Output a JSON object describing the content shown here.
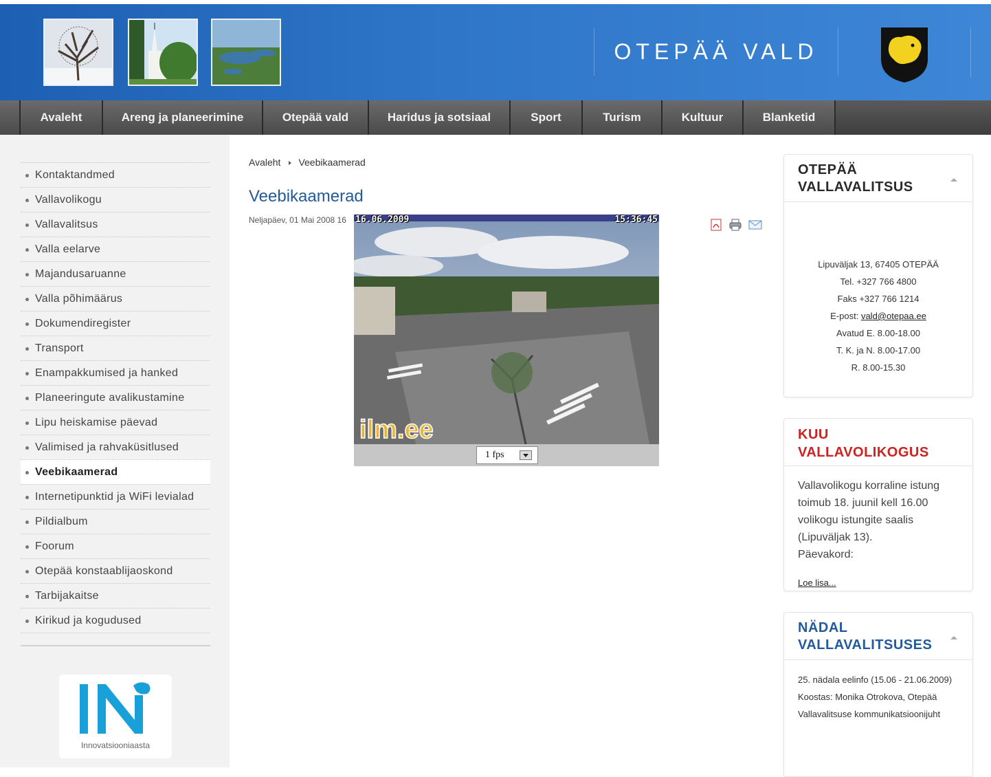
{
  "header": {
    "site_title": "OTEPÄÄ VALD",
    "colors": {
      "header_blue": "#2f76c8",
      "nav_gray": "#4a4a4a",
      "title_blue": "#245a9a",
      "news_red": "#cc2222"
    },
    "thumbnails": [
      "winter-tree-photo",
      "church-photo",
      "lake-aerial-photo"
    ],
    "crest_icon": "bear-crest-icon"
  },
  "nav": {
    "items": [
      "Avaleht",
      "Areng ja planeerimine",
      "Otepää vald",
      "Haridus ja sotsiaal",
      "Sport",
      "Turism",
      "Kultuur",
      "Blanketid"
    ]
  },
  "sidebar": {
    "items": [
      "Kontaktandmed",
      "Vallavolikogu",
      "Vallavalitsus",
      "Valla eelarve",
      "Majandusaruanne",
      "Valla põhimäärus",
      "Dokumendiregister",
      "Transport",
      "Enampakkumised ja hanked",
      "Planeeringute avalikustamine",
      "Lipu heiskamise päevad",
      "Valimised ja rahvaküsitlused",
      "Veebikaamerad",
      "Internetipunktid ja WiFi levialad",
      "Pildialbum",
      "Foorum",
      "Otepää konstaablijaoskond",
      "Tarbijakaitse",
      "Kirikud ja kogudused"
    ],
    "active": "Veebikaamerad",
    "logo_caption": "Innovatsiooniaasta"
  },
  "main": {
    "breadcrumb": [
      "Avaleht",
      "Veebikaamerad"
    ],
    "title": "Veebikaamerad",
    "date": "Neljapäev, 01 Mai 2008 16",
    "icons": [
      "pdf-icon",
      "print-icon",
      "email-icon"
    ],
    "webcam": {
      "date": "16.06.2009",
      "time": "15:36:45",
      "watermark": "ilm.ee",
      "fps_value": "1 fps"
    }
  },
  "right": {
    "contact": {
      "title_line1": "OTEPÄÄ",
      "title_line2": "VALLAVALITSUS",
      "address": "Lipuväljak 13, 67405 OTEPÄÄ",
      "phone": "Tel. +327 766 4800",
      "fax": "Faks +327 766 1214",
      "email_label": "E-post:",
      "email": "vald@otepaa.ee",
      "hours1": "Avatud E. 8.00-18.00",
      "hours2": "T. K. ja N. 8.00-17.00",
      "hours3": "R. 8.00-15.30"
    },
    "council": {
      "title": "KUU VALLAVOLIKOGUS",
      "text": "Vallavolikogu korraline istung toimub 18. juunil kell 16.00 volikogu istungite saalis (Lipuväljak 13).",
      "agenda": "Päevakord:",
      "more": "Loe lisa..."
    },
    "week": {
      "title_line1": "NÄDAL",
      "title_line2": "VALLAVALITSUSES",
      "text1": "25. nädala eelinfo (15.06 - 21.06.2009)",
      "text2": "Koostas: Monika Otrokova, Otepää Vallavalitsuse kommunikatsioonijuht"
    }
  }
}
